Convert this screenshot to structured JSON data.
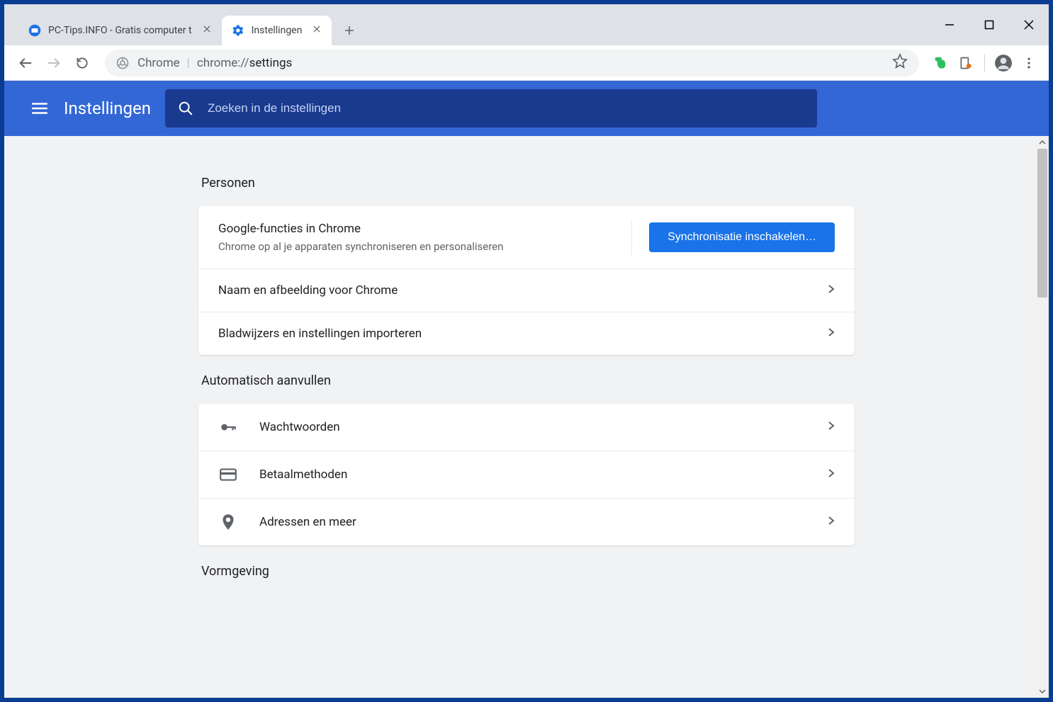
{
  "tabs": [
    {
      "title": "PC-Tips.INFO - Gratis computer t"
    },
    {
      "title": "Instellingen"
    }
  ],
  "omnibox": {
    "chrome_label": "Chrome",
    "url_prefix": "chrome://",
    "url_path": "settings"
  },
  "settings_header": {
    "title": "Instellingen",
    "search_placeholder": "Zoeken in de instellingen"
  },
  "sections": {
    "people": {
      "title": "Personen",
      "sync_row": {
        "title": "Google-functies in Chrome",
        "subtitle": "Chrome op al je apparaten synchroniseren en personaliseren",
        "button": "Synchronisatie inschakelen…"
      },
      "rows": [
        {
          "label": "Naam en afbeelding voor Chrome"
        },
        {
          "label": "Bladwijzers en instellingen importeren"
        }
      ]
    },
    "autofill": {
      "title": "Automatisch aanvullen",
      "rows": [
        {
          "label": "Wachtwoorden",
          "icon": "key"
        },
        {
          "label": "Betaalmethoden",
          "icon": "card"
        },
        {
          "label": "Adressen en meer",
          "icon": "pin"
        }
      ]
    },
    "appearance": {
      "title": "Vormgeving"
    }
  }
}
